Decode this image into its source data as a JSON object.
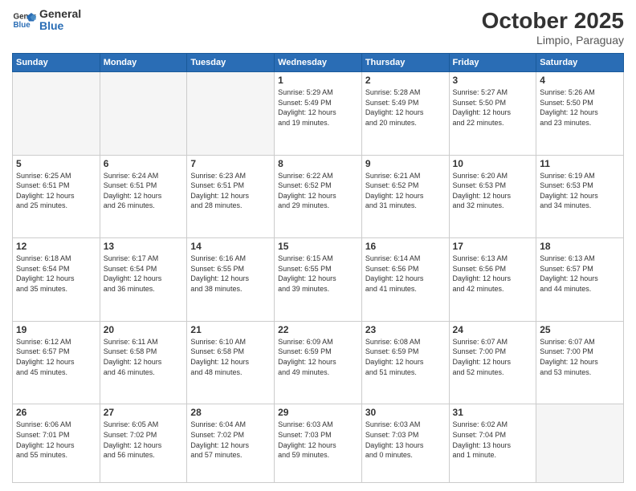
{
  "header": {
    "logo_line1": "General",
    "logo_line2": "Blue",
    "month": "October 2025",
    "location": "Limpio, Paraguay"
  },
  "weekdays": [
    "Sunday",
    "Monday",
    "Tuesday",
    "Wednesday",
    "Thursday",
    "Friday",
    "Saturday"
  ],
  "weeks": [
    [
      {
        "day": "",
        "info": ""
      },
      {
        "day": "",
        "info": ""
      },
      {
        "day": "",
        "info": ""
      },
      {
        "day": "1",
        "info": "Sunrise: 5:29 AM\nSunset: 5:49 PM\nDaylight: 12 hours\nand 19 minutes."
      },
      {
        "day": "2",
        "info": "Sunrise: 5:28 AM\nSunset: 5:49 PM\nDaylight: 12 hours\nand 20 minutes."
      },
      {
        "day": "3",
        "info": "Sunrise: 5:27 AM\nSunset: 5:50 PM\nDaylight: 12 hours\nand 22 minutes."
      },
      {
        "day": "4",
        "info": "Sunrise: 5:26 AM\nSunset: 5:50 PM\nDaylight: 12 hours\nand 23 minutes."
      }
    ],
    [
      {
        "day": "5",
        "info": "Sunrise: 6:25 AM\nSunset: 6:51 PM\nDaylight: 12 hours\nand 25 minutes."
      },
      {
        "day": "6",
        "info": "Sunrise: 6:24 AM\nSunset: 6:51 PM\nDaylight: 12 hours\nand 26 minutes."
      },
      {
        "day": "7",
        "info": "Sunrise: 6:23 AM\nSunset: 6:51 PM\nDaylight: 12 hours\nand 28 minutes."
      },
      {
        "day": "8",
        "info": "Sunrise: 6:22 AM\nSunset: 6:52 PM\nDaylight: 12 hours\nand 29 minutes."
      },
      {
        "day": "9",
        "info": "Sunrise: 6:21 AM\nSunset: 6:52 PM\nDaylight: 12 hours\nand 31 minutes."
      },
      {
        "day": "10",
        "info": "Sunrise: 6:20 AM\nSunset: 6:53 PM\nDaylight: 12 hours\nand 32 minutes."
      },
      {
        "day": "11",
        "info": "Sunrise: 6:19 AM\nSunset: 6:53 PM\nDaylight: 12 hours\nand 34 minutes."
      }
    ],
    [
      {
        "day": "12",
        "info": "Sunrise: 6:18 AM\nSunset: 6:54 PM\nDaylight: 12 hours\nand 35 minutes."
      },
      {
        "day": "13",
        "info": "Sunrise: 6:17 AM\nSunset: 6:54 PM\nDaylight: 12 hours\nand 36 minutes."
      },
      {
        "day": "14",
        "info": "Sunrise: 6:16 AM\nSunset: 6:55 PM\nDaylight: 12 hours\nand 38 minutes."
      },
      {
        "day": "15",
        "info": "Sunrise: 6:15 AM\nSunset: 6:55 PM\nDaylight: 12 hours\nand 39 minutes."
      },
      {
        "day": "16",
        "info": "Sunrise: 6:14 AM\nSunset: 6:56 PM\nDaylight: 12 hours\nand 41 minutes."
      },
      {
        "day": "17",
        "info": "Sunrise: 6:13 AM\nSunset: 6:56 PM\nDaylight: 12 hours\nand 42 minutes."
      },
      {
        "day": "18",
        "info": "Sunrise: 6:13 AM\nSunset: 6:57 PM\nDaylight: 12 hours\nand 44 minutes."
      }
    ],
    [
      {
        "day": "19",
        "info": "Sunrise: 6:12 AM\nSunset: 6:57 PM\nDaylight: 12 hours\nand 45 minutes."
      },
      {
        "day": "20",
        "info": "Sunrise: 6:11 AM\nSunset: 6:58 PM\nDaylight: 12 hours\nand 46 minutes."
      },
      {
        "day": "21",
        "info": "Sunrise: 6:10 AM\nSunset: 6:58 PM\nDaylight: 12 hours\nand 48 minutes."
      },
      {
        "day": "22",
        "info": "Sunrise: 6:09 AM\nSunset: 6:59 PM\nDaylight: 12 hours\nand 49 minutes."
      },
      {
        "day": "23",
        "info": "Sunrise: 6:08 AM\nSunset: 6:59 PM\nDaylight: 12 hours\nand 51 minutes."
      },
      {
        "day": "24",
        "info": "Sunrise: 6:07 AM\nSunset: 7:00 PM\nDaylight: 12 hours\nand 52 minutes."
      },
      {
        "day": "25",
        "info": "Sunrise: 6:07 AM\nSunset: 7:00 PM\nDaylight: 12 hours\nand 53 minutes."
      }
    ],
    [
      {
        "day": "26",
        "info": "Sunrise: 6:06 AM\nSunset: 7:01 PM\nDaylight: 12 hours\nand 55 minutes."
      },
      {
        "day": "27",
        "info": "Sunrise: 6:05 AM\nSunset: 7:02 PM\nDaylight: 12 hours\nand 56 minutes."
      },
      {
        "day": "28",
        "info": "Sunrise: 6:04 AM\nSunset: 7:02 PM\nDaylight: 12 hours\nand 57 minutes."
      },
      {
        "day": "29",
        "info": "Sunrise: 6:03 AM\nSunset: 7:03 PM\nDaylight: 12 hours\nand 59 minutes."
      },
      {
        "day": "30",
        "info": "Sunrise: 6:03 AM\nSunset: 7:03 PM\nDaylight: 13 hours\nand 0 minutes."
      },
      {
        "day": "31",
        "info": "Sunrise: 6:02 AM\nSunset: 7:04 PM\nDaylight: 13 hours\nand 1 minute."
      },
      {
        "day": "",
        "info": ""
      }
    ]
  ]
}
